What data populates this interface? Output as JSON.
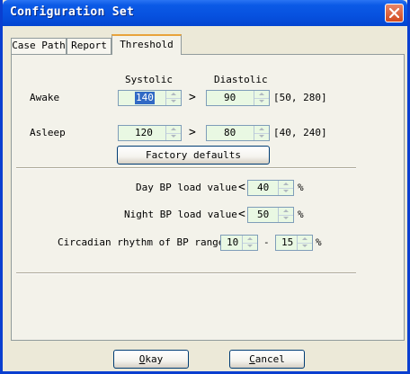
{
  "window": {
    "title": "Configuration Set"
  },
  "tabs": [
    {
      "label": "Case Path"
    },
    {
      "label": "Report"
    },
    {
      "label": "Threshold"
    }
  ],
  "threshold": {
    "col_systolic": "Systolic",
    "col_diastolic": "Diastolic",
    "awake": {
      "label": "Awake",
      "systolic": "140",
      "gt": ">",
      "diastolic": "90",
      "range": "[50, 280]"
    },
    "asleep": {
      "label": "Asleep",
      "systolic": "120",
      "gt": ">",
      "diastolic": "80",
      "range": "[40, 240]"
    },
    "factory_defaults": "Factory defaults",
    "day_load": {
      "label": "Day BP load value",
      "lt": "<",
      "value": "40",
      "unit": "%"
    },
    "night_load": {
      "label": "Night BP load value",
      "lt": "<",
      "value": "50",
      "unit": "%"
    },
    "circadian": {
      "label": "Circadian rhythm of BP ranges",
      "from": "10",
      "dash": "-",
      "to": "15",
      "unit": "%"
    }
  },
  "footer": {
    "okay_mnemonic": "O",
    "okay_rest": "kay",
    "cancel_mnemonic": "C",
    "cancel_rest": "ancel"
  },
  "colors": {
    "title_blue": "#0b5ae6",
    "close_red": "#d24a1e",
    "field_green": "#e9f8e3",
    "selection_blue": "#316ac5",
    "dialog_face": "#ece9d8"
  },
  "icons": {
    "close": "close-x-icon",
    "spin_up": "up-arrow-icon",
    "spin_down": "down-arrow-icon"
  }
}
